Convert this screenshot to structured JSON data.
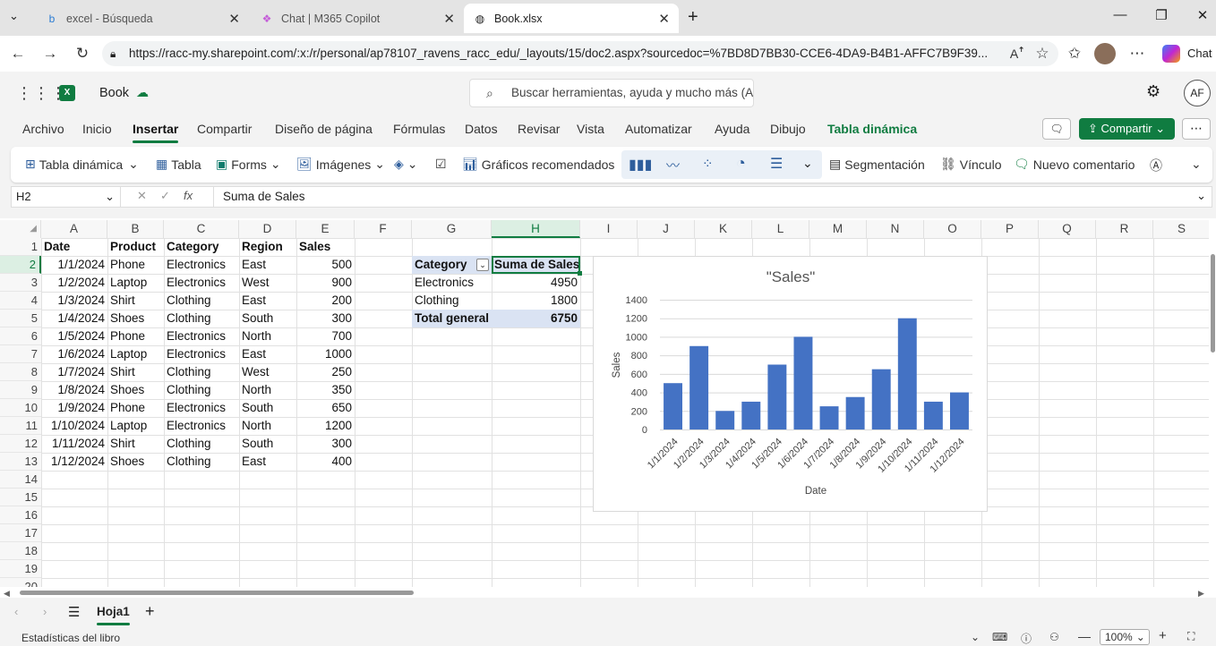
{
  "browser": {
    "tabs": [
      {
        "title": "excel - Búsqueda",
        "icon": "bing-icon"
      },
      {
        "title": "Chat | M365 Copilot",
        "icon": "copilot-icon"
      },
      {
        "title": "Book.xlsx",
        "icon": "globe-icon"
      }
    ],
    "url": "https://racc-my.sharepoint.com/:x:/r/personal/ap78107_ravens_racc_edu/_layouts/15/doc2.aspx?sourcedoc=%7BD8D7BB30-CCE6-4DA9-B4B1-AFFC7B9F39...",
    "chat_label": "Chat"
  },
  "excel": {
    "doc_name": "Book",
    "search_placeholder": "Buscar herramientas, ayuda y mucho más (A",
    "avatar": "AF",
    "menus": [
      "Archivo",
      "Inicio",
      "Insertar",
      "Compartir",
      "Diseño de página",
      "Fórmulas",
      "Datos",
      "Revisar",
      "Vista",
      "Automatizar",
      "Ayuda",
      "Dibujo",
      "Tabla dinámica"
    ],
    "share_label": "Compartir",
    "ribbon": {
      "pivot": "Tabla dinámica",
      "table": "Tabla",
      "forms": "Forms",
      "images": "Imágenes",
      "recommended": "Gráficos recomendados",
      "slicer": "Segmentación",
      "link": "Vínculo",
      "comment": "Nuevo comentario"
    },
    "name_box": "H2",
    "formula": "Suma de Sales"
  },
  "grid": {
    "columns": [
      "A",
      "B",
      "C",
      "D",
      "E",
      "F",
      "G",
      "H",
      "I",
      "J",
      "K",
      "L",
      "M",
      "N",
      "O",
      "P",
      "Q",
      "R",
      "S"
    ],
    "rows": [
      "1",
      "2",
      "3",
      "4",
      "5",
      "6",
      "7",
      "8",
      "9",
      "10",
      "11",
      "12",
      "13",
      "14",
      "15",
      "16",
      "17",
      "18",
      "19",
      "20"
    ],
    "header": [
      "Date",
      "Product",
      "Category",
      "Region",
      "Sales"
    ],
    "data": [
      [
        "1/1/2024",
        "Phone",
        "Electronics",
        "East",
        "500"
      ],
      [
        "1/2/2024",
        "Laptop",
        "Electronics",
        "West",
        "900"
      ],
      [
        "1/3/2024",
        "Shirt",
        "Clothing",
        "East",
        "200"
      ],
      [
        "1/4/2024",
        "Shoes",
        "Clothing",
        "South",
        "300"
      ],
      [
        "1/5/2024",
        "Phone",
        "Electronics",
        "North",
        "700"
      ],
      [
        "1/6/2024",
        "Laptop",
        "Electronics",
        "East",
        "1000"
      ],
      [
        "1/7/2024",
        "Shirt",
        "Clothing",
        "West",
        "250"
      ],
      [
        "1/8/2024",
        "Shoes",
        "Clothing",
        "North",
        "350"
      ],
      [
        "1/9/2024",
        "Phone",
        "Electronics",
        "South",
        "650"
      ],
      [
        "1/10/2024",
        "Laptop",
        "Electronics",
        "North",
        "1200"
      ],
      [
        "1/11/2024",
        "Shirt",
        "Clothing",
        "South",
        "300"
      ],
      [
        "1/12/2024",
        "Shoes",
        "Clothing",
        "East",
        "400"
      ]
    ],
    "pivot": {
      "header": [
        "Category",
        "Suma de Sales"
      ],
      "rows": [
        [
          "Electronics",
          "4950"
        ],
        [
          "Clothing",
          "1800"
        ]
      ],
      "total": [
        "Total general",
        "6750"
      ]
    }
  },
  "chart_data": {
    "type": "bar",
    "title": "\"Sales\"",
    "xlabel": "Date",
    "ylabel": "Sales",
    "categories": [
      "1/1/2024",
      "1/2/2024",
      "1/3/2024",
      "1/4/2024",
      "1/5/2024",
      "1/6/2024",
      "1/7/2024",
      "1/8/2024",
      "1/9/2024",
      "1/10/2024",
      "1/11/2024",
      "1/12/2024"
    ],
    "values": [
      500,
      900,
      200,
      300,
      700,
      1000,
      250,
      350,
      650,
      1200,
      300,
      400
    ],
    "ylim": [
      0,
      1400
    ],
    "yticks": [
      0,
      200,
      400,
      600,
      800,
      1000,
      1200,
      1400
    ],
    "grid": true,
    "legend": "none",
    "color": "#4472c4"
  },
  "sheet": {
    "tab": "Hoja1"
  },
  "status": {
    "left": "Estadísticas del libro",
    "zoom": "100%"
  }
}
